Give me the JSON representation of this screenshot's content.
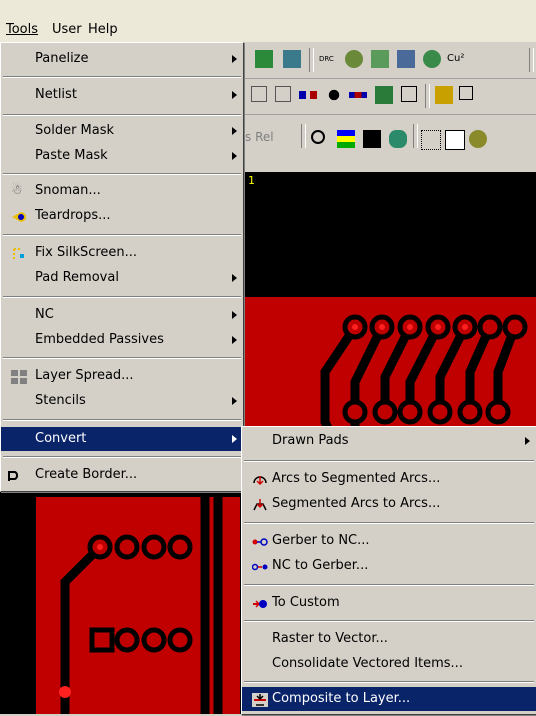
{
  "menubar": {
    "tools": "Tools",
    "user": "User",
    "help": "Help"
  },
  "toolbar": {
    "rel_label": "s Rel",
    "cu_label": "Cu²",
    "drc_label": "DRC"
  },
  "canvas": {
    "marker": "1"
  },
  "tools_menu": {
    "items": [
      {
        "label": "Panelize"
      },
      {
        "label": "Netlist"
      },
      {
        "label": "Solder Mask"
      },
      {
        "label": "Paste Mask"
      },
      {
        "label": "Snoman..."
      },
      {
        "label": "Teardrops..."
      },
      {
        "label": "Fix SilkScreen..."
      },
      {
        "label": "Pad Removal"
      },
      {
        "label": "NC"
      },
      {
        "label": "Embedded Passives"
      },
      {
        "label": "Layer Spread..."
      },
      {
        "label": "Stencils"
      },
      {
        "label": "Convert"
      },
      {
        "label": "Create Border..."
      }
    ]
  },
  "convert_menu": {
    "items": [
      {
        "label": "Drawn Pads"
      },
      {
        "label": "Arcs to Segmented Arcs..."
      },
      {
        "label": "Segmented Arcs to Arcs..."
      },
      {
        "label": "Gerber to NC..."
      },
      {
        "label": "NC to Gerber..."
      },
      {
        "label": "To Custom"
      },
      {
        "label": "Raster to Vector..."
      },
      {
        "label": "Consolidate Vectored Items..."
      },
      {
        "label": "Composite to Layer..."
      }
    ]
  },
  "colors": {
    "highlight": "#0a246a",
    "menu_bg": "#d4d0c8",
    "copper": "#c00000",
    "board": "#000000"
  }
}
